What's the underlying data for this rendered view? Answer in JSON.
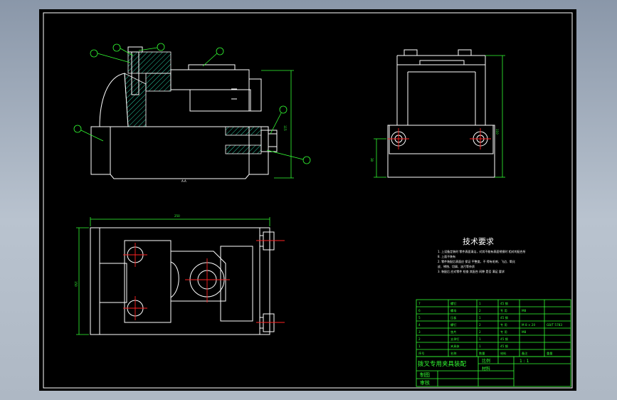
{
  "drawing": {
    "section_label": "A-A",
    "dims": {
      "front_height": "115",
      "side_height": "110",
      "side_small": "30",
      "top_width": "250",
      "top_height": "150"
    },
    "tech_requirements": {
      "title": "技术要求",
      "lines": [
        "1. 上设备定装时 零件表面清洁，对其不能有表面锈损时 相对的配合所",
        "8. 上面不装有",
        "2. 零件装配后表面应 保证 平整度，不 得有毛刺、飞边、氧化",
        "皮、锈蚀、切屑、油污等杂质",
        "3. 装配后 应对零件 检查 其配合 间隙 是否 满足 要求"
      ]
    },
    "bom_rows": [
      [
        "7",
        "螺钉",
        "1",
        "45 钢",
        "",
        ""
      ],
      [
        "6",
        "螺母",
        "2",
        "专 用",
        "M8",
        ""
      ],
      [
        "5",
        "压板",
        "1",
        "45 钢",
        "",
        ""
      ],
      [
        "4",
        "螺钉",
        "2",
        "专 用",
        "M 8 × 20",
        "GB/T 5783"
      ],
      [
        "3",
        "垫片",
        "2",
        "专 用",
        "M8",
        ""
      ],
      [
        "2",
        "支承钉",
        "1",
        "45 钢",
        "",
        ""
      ],
      [
        "1",
        "夹具体",
        "1",
        "45 钢",
        "",
        ""
      ]
    ],
    "bom_header": [
      "序号",
      "名称",
      "数量",
      "材料",
      "备注",
      "重量"
    ],
    "title_block": {
      "drawing_title": "拨叉专用夹具装配",
      "scale_label": "比例",
      "scale_value": "1 : 1",
      "material_label": "材料",
      "drawn_label": "制图",
      "checked_label": "审核"
    },
    "colors": {
      "lines": "#ffffff",
      "dimensions": "#33ff33",
      "centerlines": "#ff2222",
      "background": "#000000"
    }
  }
}
